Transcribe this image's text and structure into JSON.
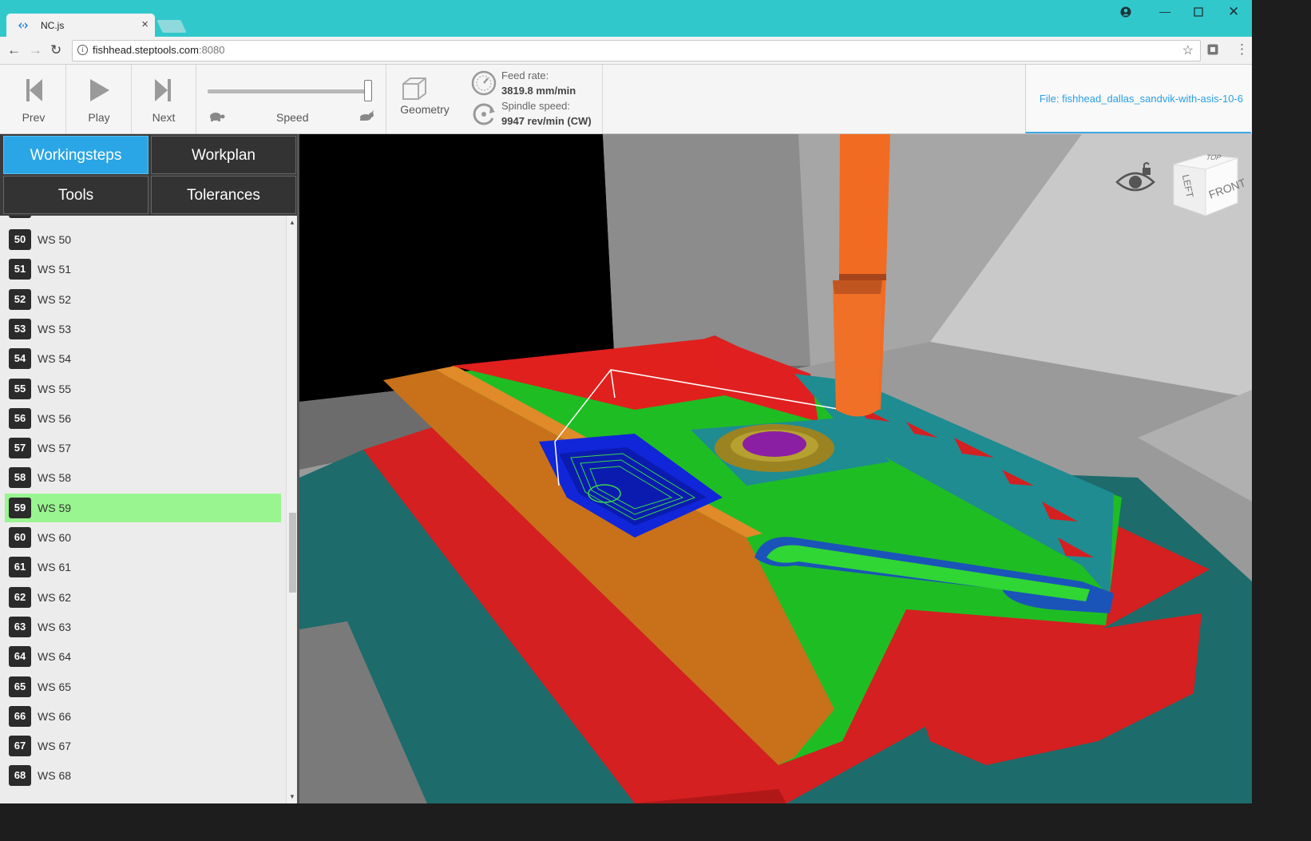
{
  "browser": {
    "tab_title": "NC.js",
    "url_host": "fishhead.steptools.com",
    "url_port": ":8080"
  },
  "toolbar": {
    "prev_label": "Prev",
    "play_label": "Play",
    "next_label": "Next",
    "speed_label": "Speed",
    "speed_level": 0.97,
    "geometry_label": "Geometry",
    "feed_rate_label": "Feed rate:",
    "feed_rate_value": "3819.8 mm/min",
    "spindle_speed_label": "Spindle speed:",
    "spindle_speed_value": "9947 rev/min (CW)",
    "file_label": "File: fishhead_dallas_sandvik-with-asis-10-6"
  },
  "sidebar": {
    "tabs": [
      {
        "label": "Workingsteps",
        "active": true
      },
      {
        "label": "Workplan",
        "active": false
      },
      {
        "label": "Tools",
        "active": false
      },
      {
        "label": "Tolerances",
        "active": false
      }
    ],
    "workingsteps": [
      {
        "num": "50",
        "name": "WS 50"
      },
      {
        "num": "51",
        "name": "WS 51"
      },
      {
        "num": "52",
        "name": "WS 52"
      },
      {
        "num": "53",
        "name": "WS 53"
      },
      {
        "num": "54",
        "name": "WS 54"
      },
      {
        "num": "55",
        "name": "WS 55"
      },
      {
        "num": "56",
        "name": "WS 56"
      },
      {
        "num": "57",
        "name": "WS 57"
      },
      {
        "num": "58",
        "name": "WS 58"
      },
      {
        "num": "59",
        "name": "WS 59",
        "selected": true
      },
      {
        "num": "60",
        "name": "WS 60"
      },
      {
        "num": "61",
        "name": "WS 61"
      },
      {
        "num": "62",
        "name": "WS 62"
      },
      {
        "num": "63",
        "name": "WS 63"
      },
      {
        "num": "64",
        "name": "WS 64"
      },
      {
        "num": "65",
        "name": "WS 65"
      },
      {
        "num": "66",
        "name": "WS 66"
      },
      {
        "num": "67",
        "name": "WS 67"
      },
      {
        "num": "68",
        "name": "WS 68"
      }
    ]
  },
  "viewcube": {
    "top": "TOP",
    "left": "LEFT",
    "front": "FRONT"
  },
  "colors": {
    "titlebar": "#31c8cc",
    "active_tab": "#2aa6e6",
    "selected_row": "#99f590",
    "file_link": "#2a9fe6",
    "tool": "#f26b22"
  },
  "icons": [
    "nc-logo-icon",
    "close-icon",
    "back-icon",
    "forward-icon",
    "reload-icon",
    "info-icon",
    "bookmark-star-icon",
    "extension-icon",
    "menu-icon",
    "account-icon",
    "minimize-icon",
    "maximize-icon",
    "window-close-icon",
    "prev-icon",
    "play-icon",
    "next-icon",
    "turtle-icon",
    "hare-icon",
    "geometry-cube-icon",
    "feed-gauge-icon",
    "spindle-icon",
    "eye-lock-icon"
  ]
}
